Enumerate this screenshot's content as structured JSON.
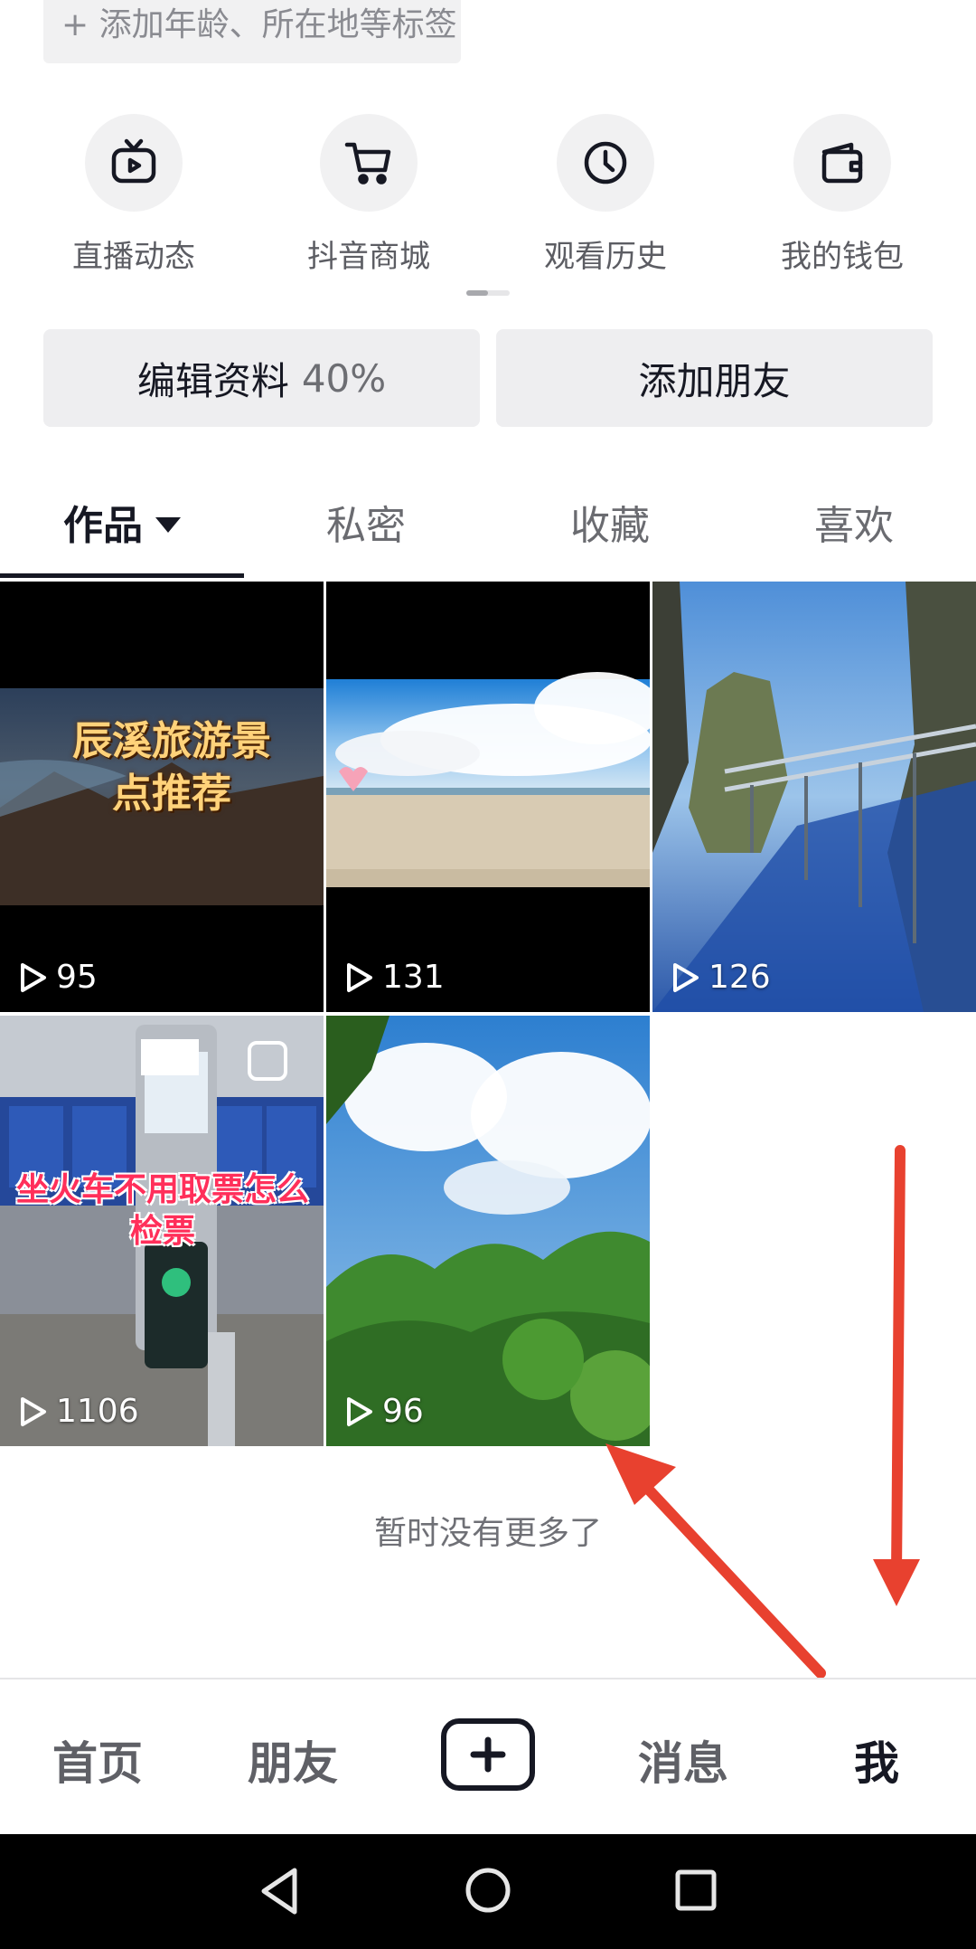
{
  "profile": {
    "tag_hint": "+ 添加年龄、所在地等标签"
  },
  "quick_entries": [
    {
      "label": "直播动态",
      "icon": "tv-icon"
    },
    {
      "label": "抖音商城",
      "icon": "cart-icon"
    },
    {
      "label": "观看历史",
      "icon": "clock-icon"
    },
    {
      "label": "我的钱包",
      "icon": "wallet-icon"
    }
  ],
  "actions": {
    "edit_profile": "编辑资料",
    "edit_progress": "40%",
    "add_friend": "添加朋友"
  },
  "tabs": [
    {
      "label": "作品",
      "active": true
    },
    {
      "label": "私密",
      "active": false
    },
    {
      "label": "收藏",
      "active": false
    },
    {
      "label": "喜欢",
      "active": false
    }
  ],
  "videos": [
    {
      "views": "95",
      "overlay_text": "辰溪旅游景点推荐"
    },
    {
      "views": "131",
      "overlay_text": ""
    },
    {
      "views": "126",
      "overlay_text": ""
    },
    {
      "views": "1106",
      "overlay_text": "坐火车不用取票怎么检票"
    },
    {
      "views": "96",
      "overlay_text": ""
    }
  ],
  "footer_hint": "暂时没有更多了",
  "bottom_nav": [
    {
      "label": "首页",
      "active": false
    },
    {
      "label": "朋友",
      "active": false
    },
    {
      "label": "消息",
      "active": false
    },
    {
      "label": "我",
      "active": true
    }
  ],
  "colors": {
    "annotation_arrow": "#e8412f",
    "text_primary": "#161823",
    "chip_bg": "#f1f1f2"
  }
}
